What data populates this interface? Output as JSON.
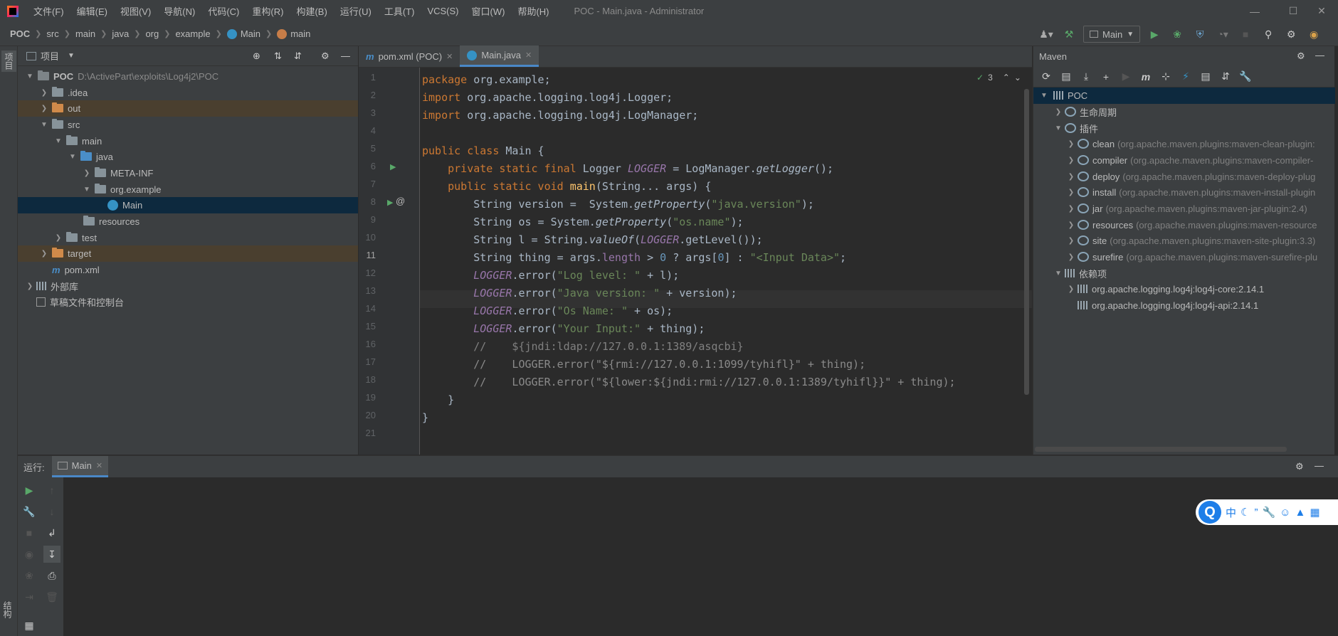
{
  "menu": [
    "文件(F)",
    "编辑(E)",
    "视图(V)",
    "导航(N)",
    "代码(C)",
    "重构(R)",
    "构建(B)",
    "运行(U)",
    "工具(T)",
    "VCS(S)",
    "窗口(W)",
    "帮助(H)"
  ],
  "window_title": "POC - Main.java - Administrator",
  "breadcrumbs": [
    "POC",
    "src",
    "main",
    "java",
    "org",
    "example",
    "Main",
    "main"
  ],
  "run_config": "Main",
  "left_stripe": {
    "project_tab": "项目",
    "structure_tab": "结构"
  },
  "project": {
    "title": "项目",
    "tree": [
      {
        "label": "POC",
        "path": "D:\\ActivePart\\exploits\\Log4j2\\POC"
      },
      {
        "label": ".idea"
      },
      {
        "label": "out"
      },
      {
        "label": "src"
      },
      {
        "label": "main"
      },
      {
        "label": "java"
      },
      {
        "label": "META-INF"
      },
      {
        "label": "org.example"
      },
      {
        "label": "Main"
      },
      {
        "label": "resources"
      },
      {
        "label": "test"
      },
      {
        "label": "target"
      },
      {
        "label": "pom.xml"
      },
      {
        "label": "外部库"
      },
      {
        "label": "草稿文件和控制台"
      }
    ]
  },
  "editor": {
    "tabs": [
      "pom.xml (POC)",
      "Main.java"
    ],
    "inspection_count": "3",
    "line_numbers": [
      "1",
      "2",
      "3",
      "4",
      "5",
      "6",
      "7",
      "8",
      "9",
      "10",
      "11",
      "12",
      "13",
      "14",
      "15",
      "16",
      "17",
      "18",
      "19",
      "20",
      "21"
    ]
  },
  "maven": {
    "title": "Maven",
    "root": "POC",
    "lifecycle": "生命周期",
    "plugins_label": "插件",
    "plugins": [
      {
        "name": "clean",
        "detail": "(org.apache.maven.plugins:maven-clean-plugin:"
      },
      {
        "name": "compiler",
        "detail": "(org.apache.maven.plugins:maven-compiler-"
      },
      {
        "name": "deploy",
        "detail": "(org.apache.maven.plugins:maven-deploy-plug"
      },
      {
        "name": "install",
        "detail": "(org.apache.maven.plugins:maven-install-plugin"
      },
      {
        "name": "jar",
        "detail": "(org.apache.maven.plugins:maven-jar-plugin:2.4)"
      },
      {
        "name": "resources",
        "detail": "(org.apache.maven.plugins:maven-resource"
      },
      {
        "name": "site",
        "detail": "(org.apache.maven.plugins:maven-site-plugin:3.3)"
      },
      {
        "name": "surefire",
        "detail": "(org.apache.maven.plugins:maven-surefire-plu"
      }
    ],
    "dependencies_label": "依赖项",
    "dependencies": [
      "org.apache.logging.log4j:log4j-core:2.14.1",
      "org.apache.logging.log4j:log4j-api:2.14.1"
    ]
  },
  "run": {
    "label": "运行:",
    "tab": "Main"
  },
  "ime": {
    "chinese": "中"
  },
  "colors": {
    "accent": "#4a88c7",
    "keyword": "#cc7832",
    "string": "#6a8759",
    "selection": "#0d293e"
  }
}
